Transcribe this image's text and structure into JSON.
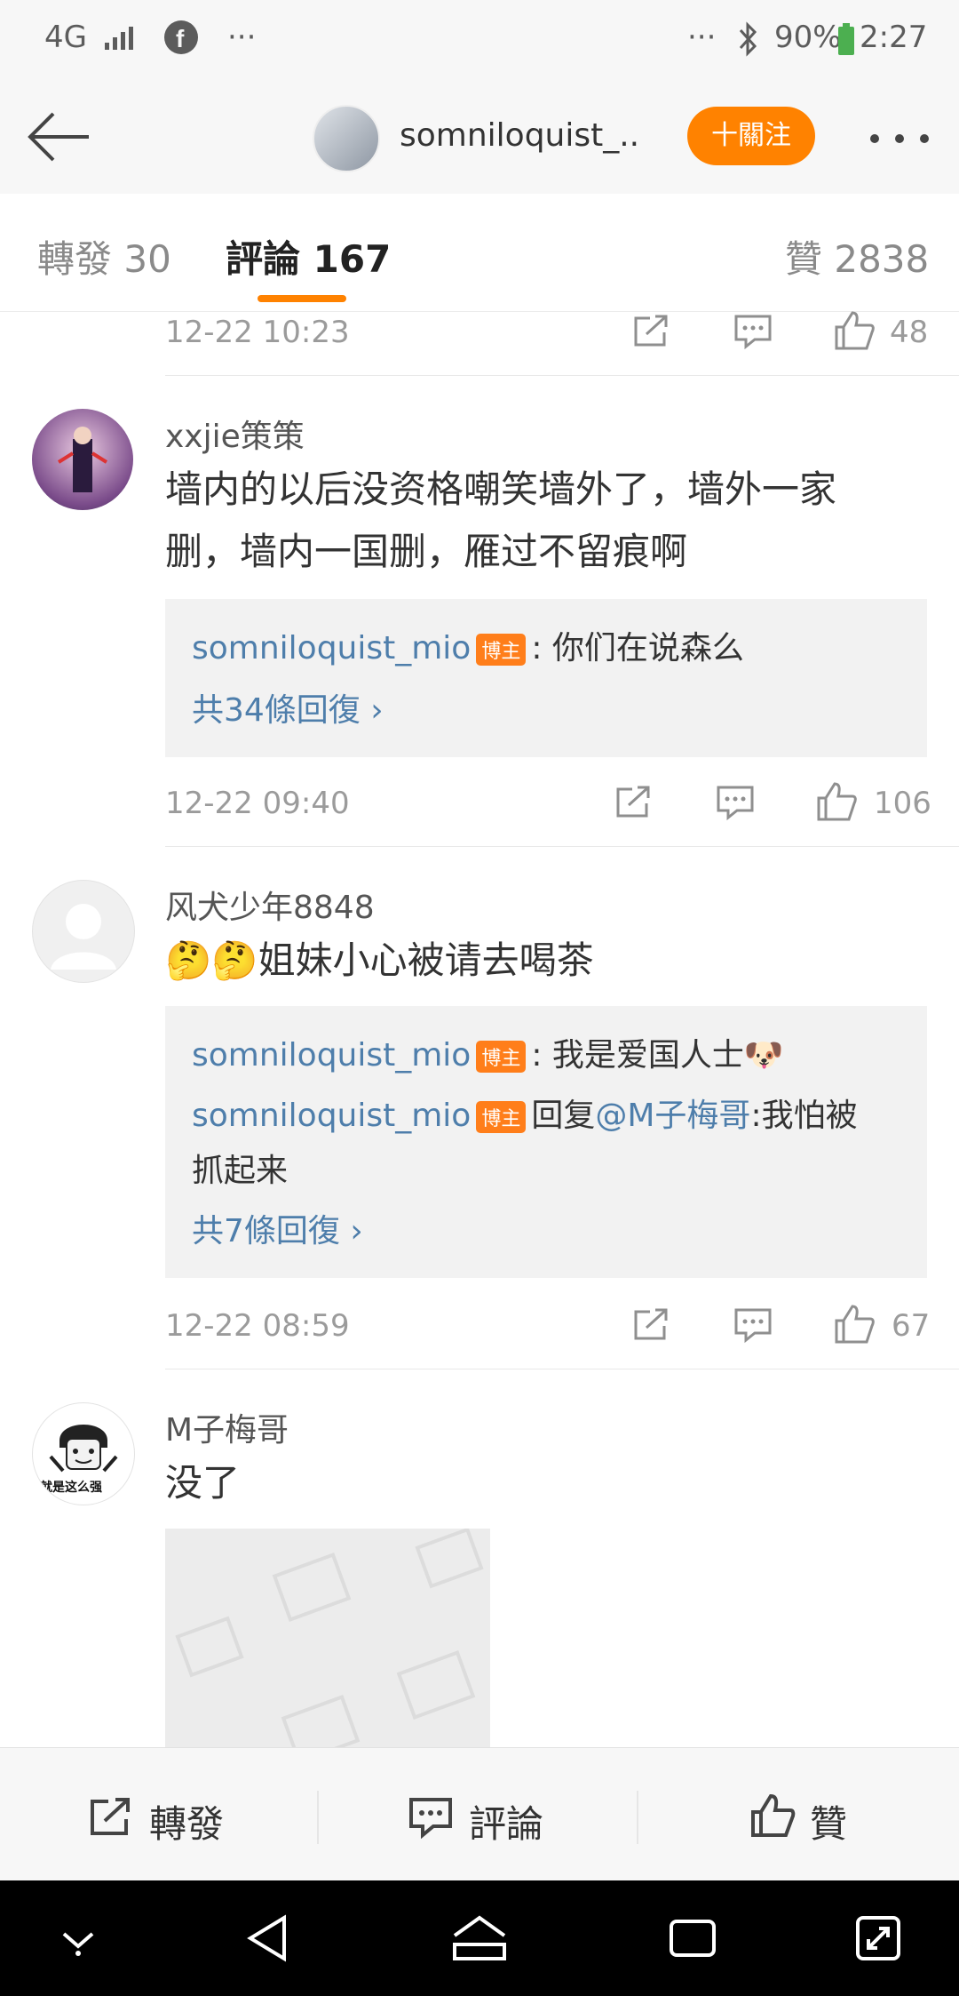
{
  "status": {
    "network": "4G",
    "battery": "90%",
    "time": "2:27",
    "more_left": "···",
    "more_right": "···"
  },
  "header": {
    "title": "somniloquist_...",
    "follow": "十關注"
  },
  "tabs": {
    "repost": "轉發 30",
    "comments": "評論 167",
    "likes": "贊 2838"
  },
  "top_meta": {
    "time": "12-22 10:23",
    "likes": "48"
  },
  "comments": [
    {
      "user": "xxjie策策",
      "text_line1": "墙内的以后没资格嘲笑墙外了，墙外一家",
      "text_line2": "删，墙内一国删，雁过不留痕啊",
      "reply_user": "somniloquist_mio",
      "badge": "博主",
      "reply_text": ": 你们在说森么",
      "more": "共34條回復 ›",
      "time": "12-22 09:40",
      "likes": "106"
    },
    {
      "user": "风犬少年8848",
      "text": "🤔🤔姐妹小心被请去喝茶",
      "reply1_user": "somniloquist_mio",
      "reply1_text": ": 我是爱国人士🐶",
      "reply2_user": "somniloquist_mio",
      "reply2_prefix": "回复",
      "reply2_mention": "@M子梅哥",
      "reply2_text": ":我怕被",
      "reply2_line2": "抓起来",
      "badge": "博主",
      "more": "共7條回復 ›",
      "time": "12-22 08:59",
      "likes": "67"
    },
    {
      "user": "M子梅哥",
      "text": "没了",
      "avatar_caption": "就是这么强"
    }
  ],
  "bottom": {
    "repost": "轉發",
    "comment": "評論",
    "like": "贊"
  },
  "colors": {
    "accent": "#ff8200",
    "link": "#4e7eab"
  }
}
